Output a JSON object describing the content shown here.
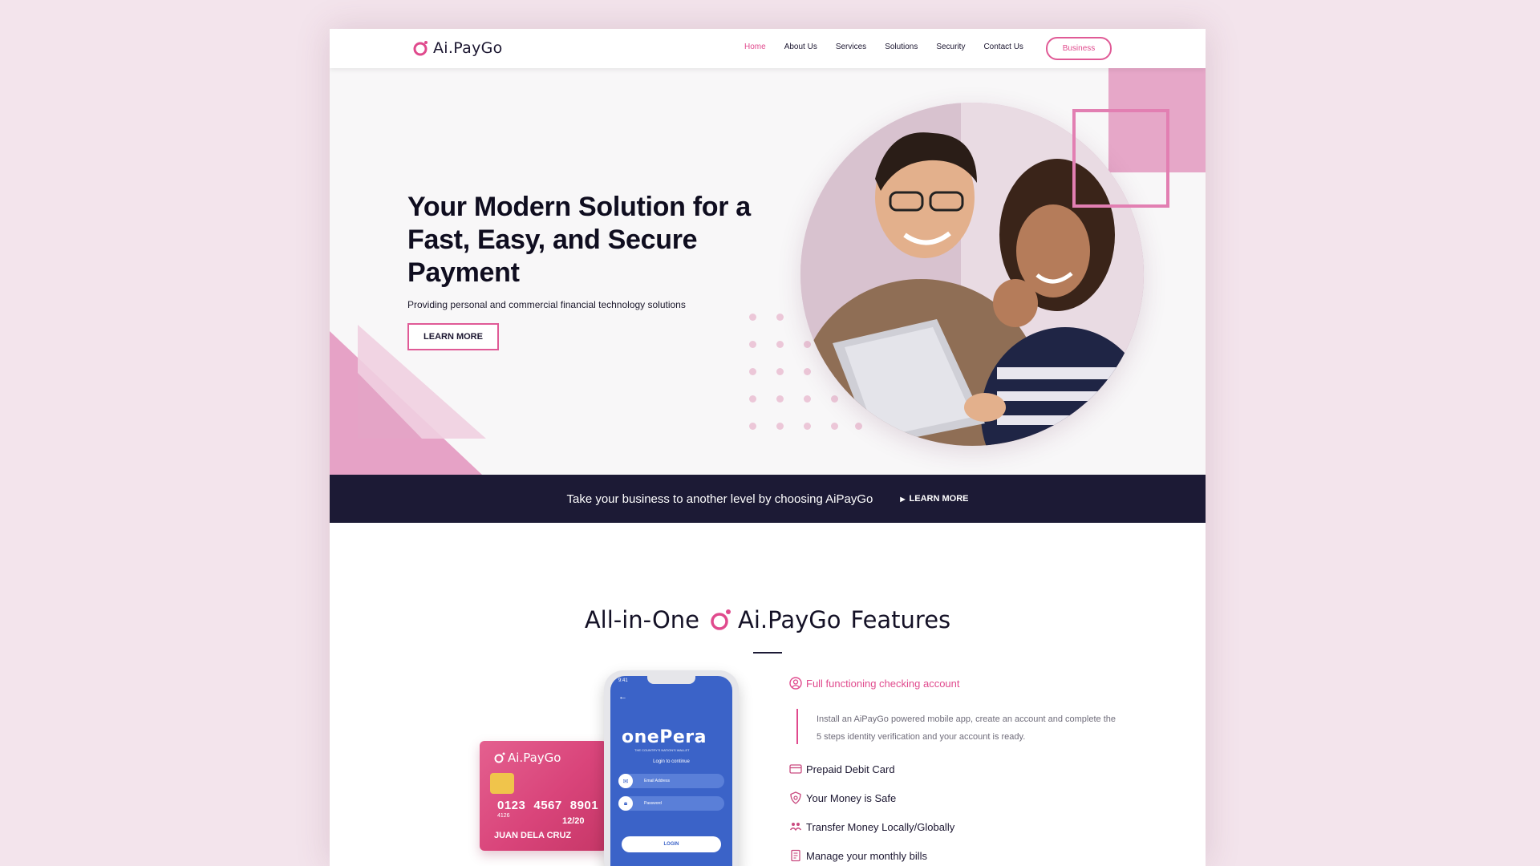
{
  "brand": {
    "name": "Ai.PayGo",
    "accent": "#e04a8d",
    "dark": "#1c1a35"
  },
  "nav": {
    "items": [
      {
        "label": "Home",
        "active": true
      },
      {
        "label": "About Us",
        "active": false
      },
      {
        "label": "Services",
        "active": false
      },
      {
        "label": "Solutions",
        "active": false
      },
      {
        "label": "Security",
        "active": false
      },
      {
        "label": "Contact Us",
        "active": false
      }
    ],
    "business_label": "Business"
  },
  "hero": {
    "title": "Your Modern Solution for a Fast, Easy, and Secure Payment",
    "subtitle": "Providing personal and commercial financial technology solutions",
    "button_label": "LEARN MORE"
  },
  "band": {
    "text": "Take your business to another level by choosing AiPayGo",
    "link_label": "LEARN MORE"
  },
  "features": {
    "title_prefix": "All-in-One",
    "title_brand": "Ai.PayGo",
    "title_suffix": "Features",
    "card": {
      "logo": "Ai.PayGo",
      "number": [
        "0123",
        "4567",
        "8901"
      ],
      "small": "4126",
      "expiry": "12/20",
      "holder": "JUAN DELA CRUZ"
    },
    "phone": {
      "time": "9:41",
      "brand": "onePera",
      "tagline": "THE COUNTRY'S NATION'S WALLET",
      "login_hint": "Login to continue",
      "email_placeholder": "Email Address",
      "password_placeholder": "Password",
      "login_button": "LOGIN"
    },
    "highlight": {
      "title": "Full functioning checking account",
      "description": "Install an AiPayGo powered mobile app, create an account and complete the 5 steps identity verification and your account is ready.",
      "icon": "user-circle-icon"
    },
    "items": [
      {
        "label": "Prepaid Debit Card",
        "icon": "credit-card-icon"
      },
      {
        "label": "Your Money is Safe",
        "icon": "shield-icon"
      },
      {
        "label": "Transfer Money Locally/Globally",
        "icon": "transfer-people-icon"
      },
      {
        "label": "Manage your monthly bills",
        "icon": "bill-icon"
      }
    ]
  }
}
